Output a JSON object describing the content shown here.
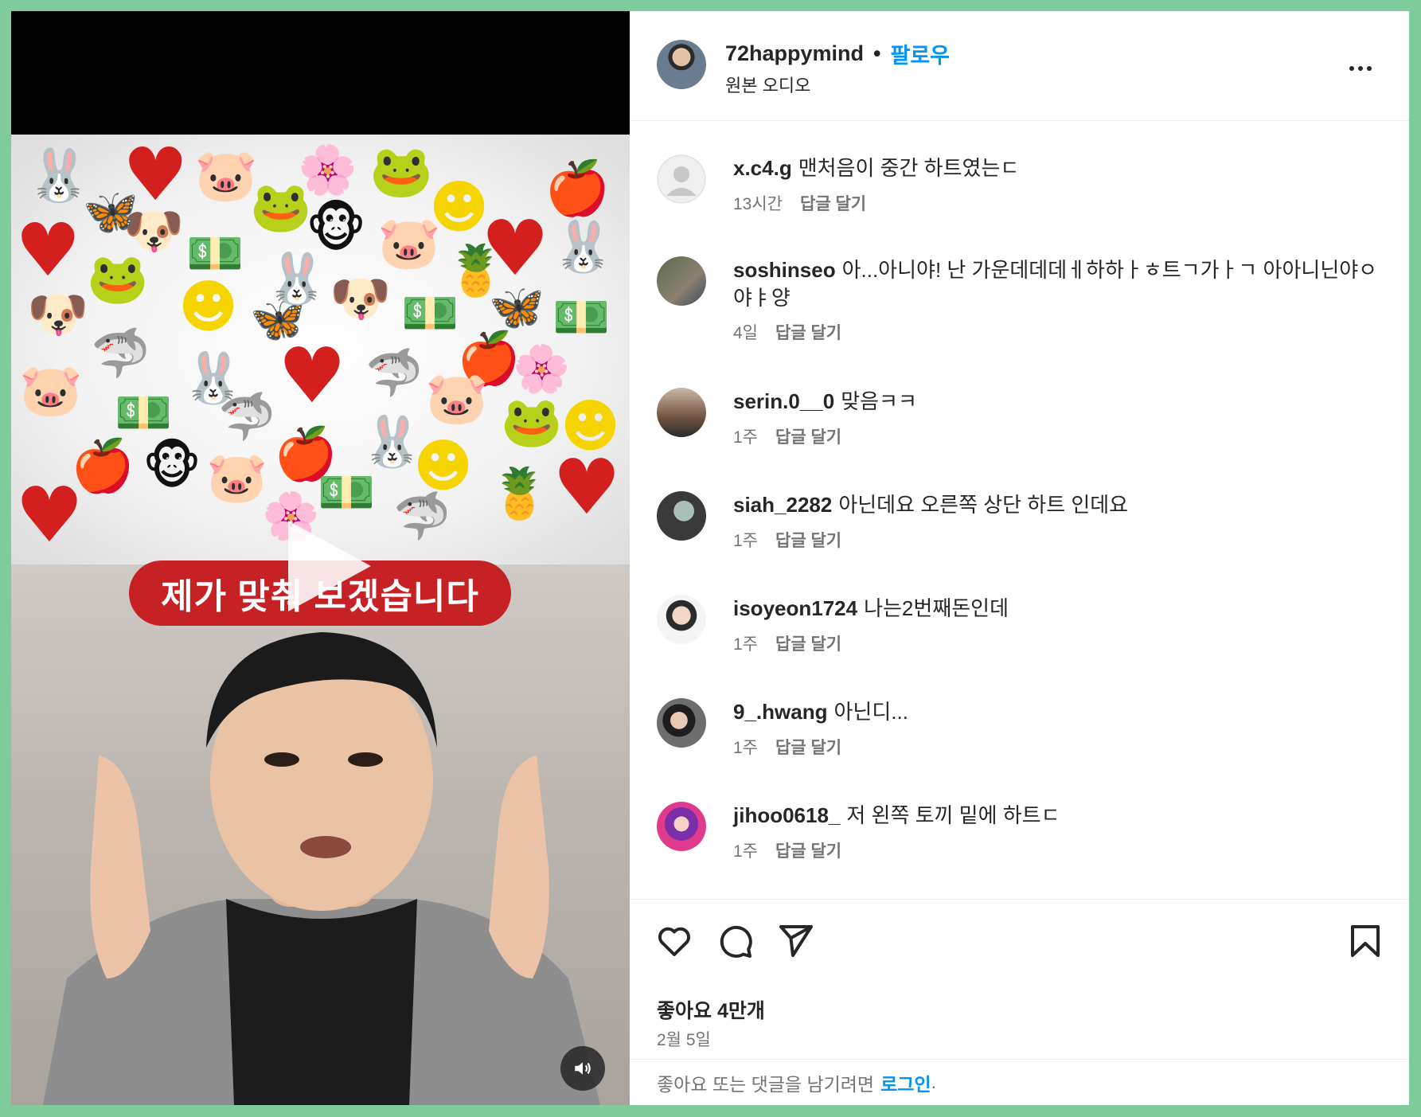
{
  "post": {
    "username": "72happymind",
    "separator": "•",
    "follow_label": "팔로우",
    "audio_label": "원본 오디오",
    "more_icon": "more-horizontal-icon"
  },
  "video": {
    "banner_text": "제가 맞춰 보겠습니다",
    "play_icon": "play-icon",
    "volume_icon": "volume-icon"
  },
  "comments": [
    {
      "user": "x.c4.g",
      "text": "맨처음이 중간 하트였는ㄷ",
      "time": "13시간",
      "reply": "답글 달기"
    },
    {
      "user": "soshinseo",
      "text": "아...아니야! 난 가운데데데ㅔ하하ㅏㅎ트ㄱ가ㅏㄱ 아아니닌야ㅇ야ㅑ양",
      "time": "4일",
      "reply": "답글 달기"
    },
    {
      "user": "serin.0__0",
      "text": "맞음ㅋㅋ",
      "time": "1주",
      "reply": "답글 달기"
    },
    {
      "user": "siah_2282",
      "text": "아닌데요 오른쪽 상단 하트 인데요",
      "time": "1주",
      "reply": "답글 달기"
    },
    {
      "user": "isoyeon1724",
      "text": "나는2번째돈인데",
      "time": "1주",
      "reply": "답글 달기"
    },
    {
      "user": "9_.hwang",
      "text": "아닌디...",
      "time": "1주",
      "reply": "답글 달기"
    },
    {
      "user": "jihoo0618_",
      "text": "저 왼쪽 토끼 밑에 하트ㄷ",
      "time": "1주",
      "reply": "답글 달기"
    }
  ],
  "actions": {
    "like_icon": "heart-icon",
    "comment_icon": "comment-icon",
    "share_icon": "send-icon",
    "save_icon": "bookmark-icon",
    "likes": "좋아요 4만개",
    "date": "2월 5일"
  },
  "login_prompt": {
    "text": "좋아요 또는 댓글을 남기려면",
    "link": "로그인",
    "suffix": "."
  },
  "colors": {
    "background": "#7fcb9c",
    "link": "#0095f6",
    "banner": "#c62124",
    "muted": "#737373"
  }
}
